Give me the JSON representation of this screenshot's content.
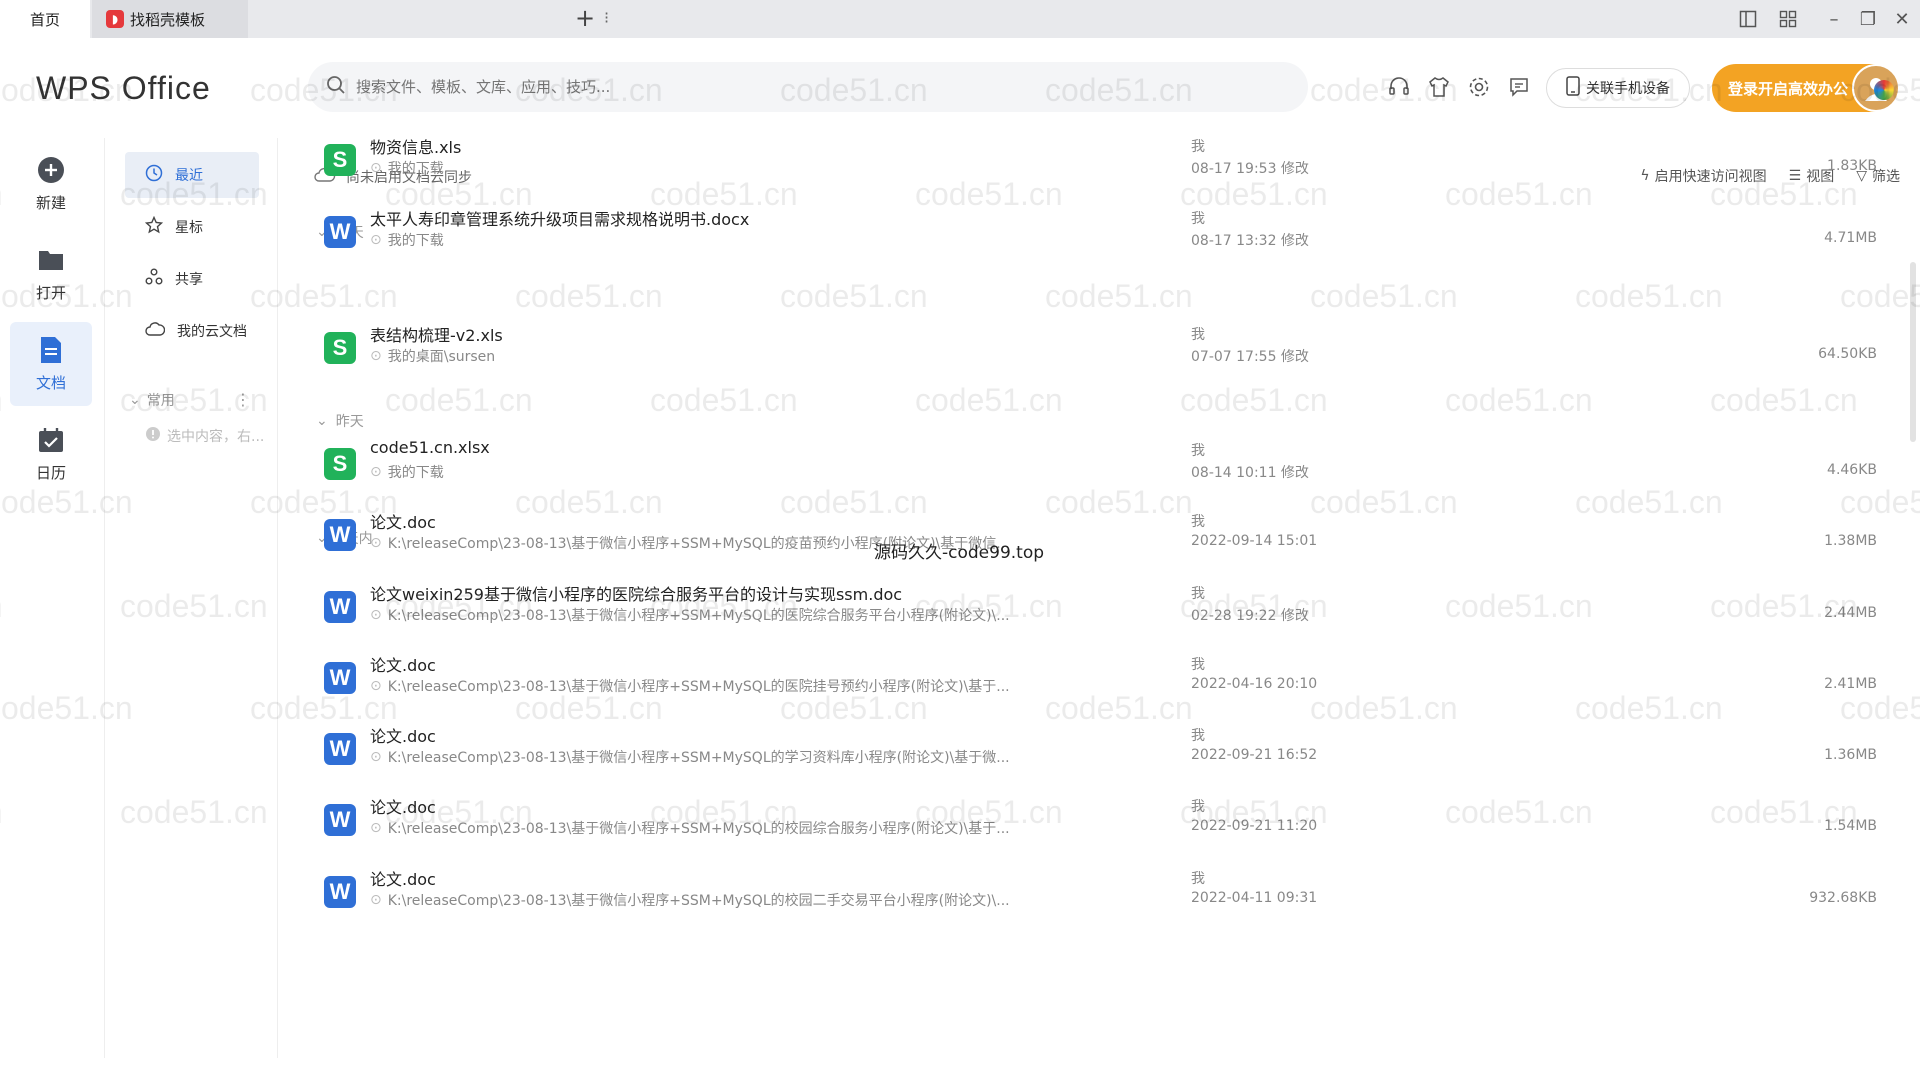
{
  "tabs": [
    {
      "label": "首页"
    },
    {
      "label": "找稻壳模板"
    }
  ],
  "header": {
    "logo": "WPS Office",
    "search_placeholder": "搜索文件、模板、文库、应用、技巧...",
    "phone_button": "关联手机设备",
    "login_button": "登录开启高效办公"
  },
  "nav": {
    "items": [
      {
        "label": "新建",
        "icon": "plus-circle-icon"
      },
      {
        "label": "打开",
        "icon": "folder-icon"
      },
      {
        "label": "文档",
        "icon": "document-icon"
      },
      {
        "label": "日历",
        "icon": "calendar-icon"
      }
    ],
    "active": "文档"
  },
  "side": {
    "items": [
      {
        "label": "最近",
        "icon": "clock-icon"
      },
      {
        "label": "星标",
        "icon": "star-icon"
      },
      {
        "label": "共享",
        "icon": "share-icon"
      },
      {
        "label": "我的云文档",
        "icon": "cloud-icon"
      }
    ],
    "group_label": "常用",
    "hint": "选中内容，右..."
  },
  "main": {
    "cloud_notice": "尚未启用文档云同步",
    "tools": [
      "启用快速访问视图",
      "视图",
      "筛选"
    ],
    "groups": [
      {
        "label": "今天"
      },
      {
        "label": "昨天"
      },
      {
        "label": "7天内"
      }
    ],
    "files": [
      {
        "name": "物资信息.xls",
        "path": "我的下载",
        "owner": "我",
        "date": "08-17 19:53 修改",
        "size": "1.83KB",
        "type": "s"
      },
      {
        "name": "太平人寿印章管理系统升级项目需求规格说明书.docx",
        "path": "我的下载",
        "owner": "我",
        "date": "08-17 13:32 修改",
        "size": "4.71MB",
        "type": "w"
      },
      {
        "name": "表结构梳理-v2.xls",
        "path": "我的桌面\\sursen",
        "owner": "我",
        "date": "07-07 17:55 修改",
        "size": "64.50KB",
        "type": "s"
      },
      {
        "name": "code51.cn.xlsx",
        "path": "我的下载",
        "owner": "我",
        "date": "08-14 10:11 修改",
        "size": "4.46KB",
        "type": "s"
      },
      {
        "name": "论文.doc",
        "path": "K:\\releaseComp\\23-08-13\\基于微信小程序+SSM+MySQL的疫苗预约小程序(附论文)\\基于微信...",
        "owner": "我",
        "date": "2022-09-14 15:01",
        "size": "1.38MB",
        "type": "w"
      },
      {
        "name": "论文weixin259基于微信小程序的医院综合服务平台的设计与实现ssm.doc",
        "path": "K:\\releaseComp\\23-08-13\\基于微信小程序+SSM+MySQL的医院综合服务平台小程序(附论文)\\...",
        "owner": "我",
        "date": "02-28 19:22 修改",
        "size": "2.44MB",
        "type": "w"
      },
      {
        "name": "论文.doc",
        "path": "K:\\releaseComp\\23-08-13\\基于微信小程序+SSM+MySQL的医院挂号预约小程序(附论文)\\基于...",
        "owner": "我",
        "date": "2022-04-16 20:10",
        "size": "2.41MB",
        "type": "w"
      },
      {
        "name": "论文.doc",
        "path": "K:\\releaseComp\\23-08-13\\基于微信小程序+SSM+MySQL的学习资料库小程序(附论文)\\基于微...",
        "owner": "我",
        "date": "2022-09-21 16:52",
        "size": "1.36MB",
        "type": "w"
      },
      {
        "name": "论文.doc",
        "path": "K:\\releaseComp\\23-08-13\\基于微信小程序+SSM+MySQL的校园综合服务小程序(附论文)\\基于...",
        "owner": "我",
        "date": "2022-09-21 11:20",
        "size": "1.54MB",
        "type": "w"
      },
      {
        "name": "论文.doc",
        "path": "K:\\releaseComp\\23-08-13\\基于微信小程序+SSM+MySQL的校园二手交易平台小程序(附论文)\\...",
        "owner": "我",
        "date": "2022-04-11 09:31",
        "size": "932.68KB",
        "type": "w"
      }
    ]
  },
  "overlay_text": "源码久久-code99.top",
  "watermark": "code51.cn",
  "colors": {
    "accent": "#2f6fd6",
    "login": "#f3a323",
    "sheet": "#21b25a",
    "word": "#2f6fd6"
  }
}
